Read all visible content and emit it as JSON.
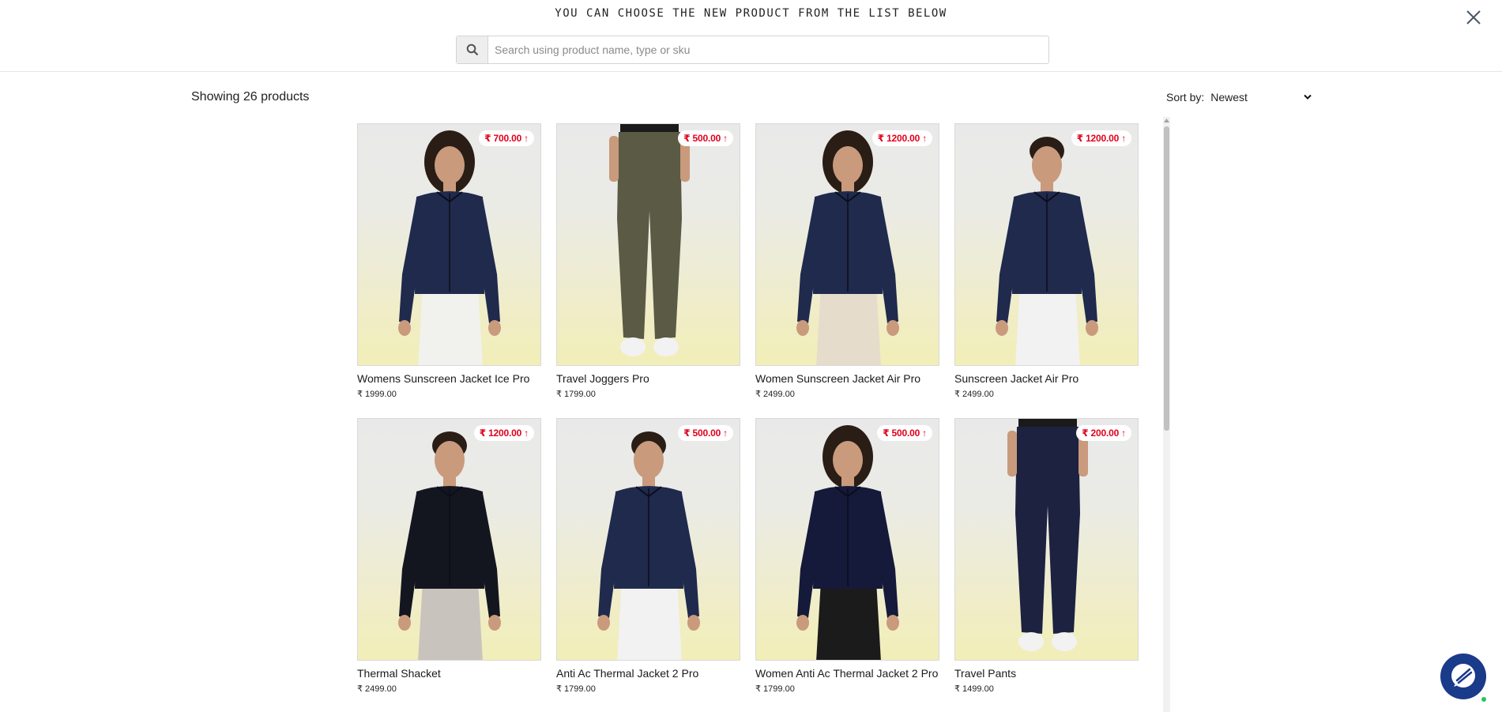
{
  "header": {
    "title": "YOU CAN CHOOSE THE NEW PRODUCT FROM THE LIST BELOW",
    "close_icon": "close-icon"
  },
  "search": {
    "icon": "search-icon",
    "placeholder": "Search using product name, type or sku",
    "value": ""
  },
  "listing": {
    "count_text": "Showing 26 products",
    "sort_label": "Sort by:",
    "sort_value": "Newest"
  },
  "products": [
    {
      "name": "Womens Sunscreen Jacket Ice Pro",
      "price": "₹ 1999.00",
      "badge": "₹ 700.00 ↑",
      "figure": "woman-jacket"
    },
    {
      "name": "Travel Joggers Pro",
      "price": "₹ 1799.00",
      "badge": "₹ 500.00 ↑",
      "figure": "pants-olive"
    },
    {
      "name": "Women Sunscreen Jacket Air Pro",
      "price": "₹ 2499.00",
      "badge": "₹ 1200.00 ↑",
      "figure": "woman-jacket-loose"
    },
    {
      "name": "Sunscreen Jacket Air Pro",
      "price": "₹ 2499.00",
      "badge": "₹ 1200.00 ↑",
      "figure": "man-jacket"
    },
    {
      "name": "Thermal Shacket",
      "price": "₹ 2499.00",
      "badge": "₹ 1200.00 ↑",
      "figure": "man-shirt"
    },
    {
      "name": "Anti Ac Thermal Jacket 2 Pro",
      "price": "₹ 1799.00",
      "badge": "₹ 500.00 ↑",
      "figure": "man-jacket-fitted"
    },
    {
      "name": "Women Anti Ac Thermal Jacket 2 Pro",
      "price": "₹ 1799.00",
      "badge": "₹ 500.00 ↑",
      "figure": "woman-jacket-dark"
    },
    {
      "name": "Travel Pants",
      "price": "₹ 1499.00",
      "badge": "₹ 200.00 ↑",
      "figure": "pants-navy"
    }
  ],
  "colors": {
    "badge_text": "#e0001b",
    "navy_garment": "#1f2a4d",
    "chat_button": "#1a3a8a",
    "online_dot": "#22c55e"
  },
  "chat": {
    "icon": "chat-icon"
  }
}
